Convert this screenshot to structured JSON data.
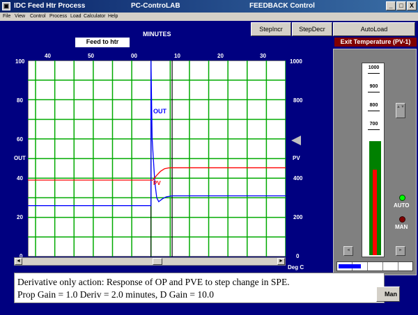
{
  "window": {
    "app_title": "IDC Feed Htr Process",
    "center_title": "PC-ControLAB",
    "right_title": "FEEDBACK Control",
    "btn_min": "_",
    "btn_max": "□",
    "btn_close": "X"
  },
  "menu": [
    "File",
    "View",
    "Control",
    "Process",
    "Load",
    "Calculator",
    "Help"
  ],
  "toolbar": {
    "step_incr": "StepIncr",
    "step_decr": "StepDecr",
    "auto_load": "AutoLoad"
  },
  "header": {
    "minutes_label": "MINUTES",
    "feed_label": "Feed to htr",
    "exit_label": "Exit Temperature   (PV-1)"
  },
  "chart_data": {
    "type": "line",
    "x_ticks_top": [
      "40",
      "50",
      "00",
      "10",
      "20",
      "30"
    ],
    "y_left_ticks": [
      "100",
      "80",
      "60",
      "40",
      "20",
      "0"
    ],
    "y_right_ticks": [
      "1000",
      "800",
      "600",
      "400",
      "200",
      "0"
    ],
    "left_axis_label": "OUT",
    "right_axis_label": "PV",
    "right_unit": "Deg C",
    "xlim_minutes": [
      -32,
      35
    ],
    "ylim_left": [
      0,
      100
    ],
    "ylim_right": [
      0,
      1000
    ],
    "series": [
      {
        "name": "OUT",
        "color": "#0000ff",
        "x": [
          -32,
          0,
          0,
          0.3,
          1.0,
          1.5,
          2.0,
          3.0,
          4.0,
          5.5,
          8,
          12,
          20,
          35
        ],
        "y": [
          26,
          26,
          100,
          60,
          38,
          30,
          28,
          29.5,
          30.5,
          31,
          31,
          31,
          31,
          31
        ]
      },
      {
        "name": "PV",
        "color": "#ff0000",
        "x": [
          -32,
          0,
          0.5,
          1.5,
          2.5,
          3.5,
          4.5,
          5.5,
          8,
          35
        ],
        "y": [
          39,
          39,
          39,
          41.5,
          43.5,
          44.8,
          45.2,
          45.3,
          45.3,
          45.3
        ]
      }
    ]
  },
  "gauge": {
    "ticks": [
      "1000",
      "900",
      "800",
      "700"
    ],
    "sp_fraction": 0.6,
    "pv_fraction": 0.45
  },
  "modes": {
    "auto": "AUTO",
    "man": "MAN"
  },
  "progress": {
    "value_fraction": 0.3
  },
  "caption": {
    "line1": "Derivative only action: Response of OP and PVE to step change in SPE.",
    "line2": "Prop Gain = 1.0 Deriv = 2.0 minutes, D Gain = 10.0"
  },
  "man_button_label": "Man",
  "colors": {
    "grid": "#00aa00",
    "background": "#000080",
    "plot_bg": "#ffffff"
  }
}
